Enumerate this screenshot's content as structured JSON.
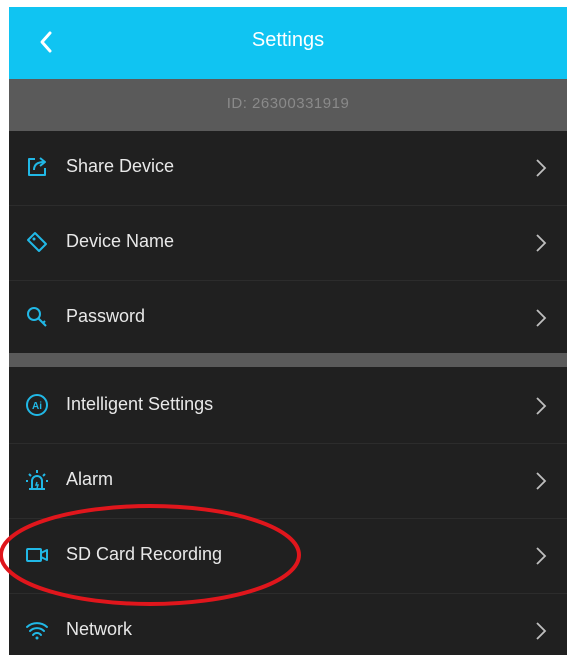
{
  "header": {
    "title": "Settings",
    "back_icon": "chevron-left-icon",
    "background_color": "#10c4f2"
  },
  "device": {
    "id_text": "ID: 26300331919"
  },
  "section1": {
    "items": [
      {
        "label": "Share Device",
        "icon": "share-icon"
      },
      {
        "label": "Device Name",
        "icon": "tag-icon"
      },
      {
        "label": "Password",
        "icon": "key-icon"
      }
    ]
  },
  "section2": {
    "items": [
      {
        "label": "Intelligent Settings",
        "icon": "ai-icon"
      },
      {
        "label": "Alarm",
        "icon": "alarm-icon"
      },
      {
        "label": "SD Card Recording",
        "icon": "camera-icon"
      },
      {
        "label": "Network",
        "icon": "wifi-icon"
      }
    ]
  },
  "annotation": {
    "highlight_color": "#e0161c",
    "highlighted_item": "SD Card Recording"
  },
  "colors": {
    "icon_accent": "#21b8e6",
    "row_background": "#202020",
    "separator": "#5a5a5a"
  }
}
